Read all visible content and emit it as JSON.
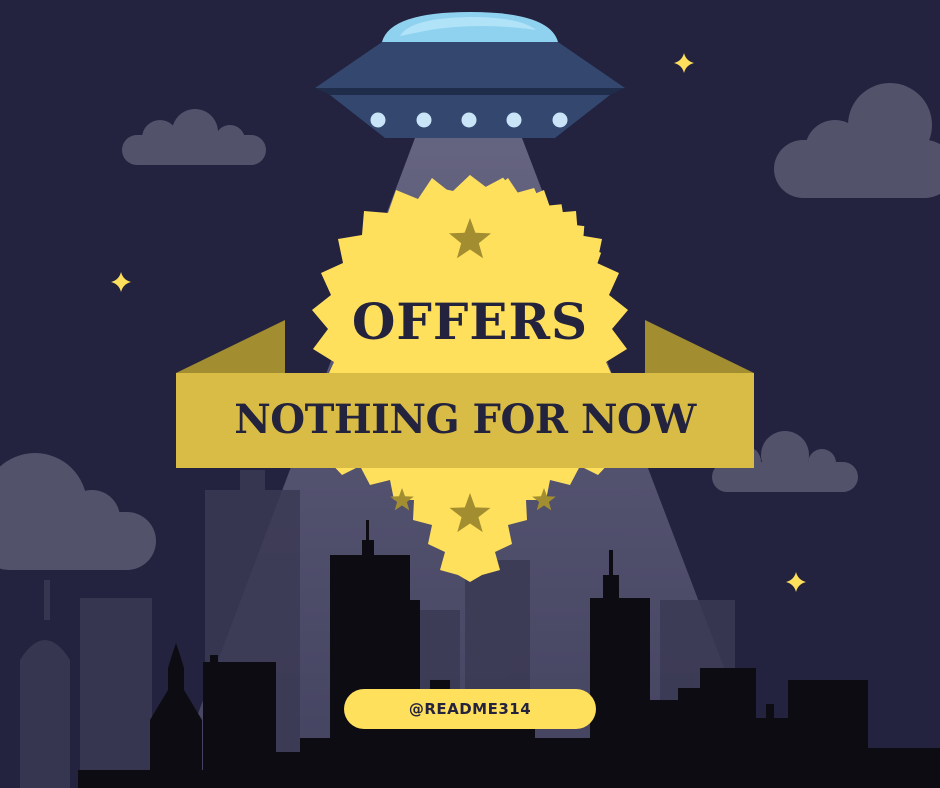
{
  "headline": "OFFERS",
  "banner": "NOTHING FOR NOW",
  "handle": "@README314",
  "colors": {
    "sky": "#23223f",
    "yellow": "#ffe05d",
    "ribbon": "#d8bc45",
    "text": "#24233e",
    "cloud": "#53526b",
    "ufo": "#32456e",
    "dome": "#8fd2f0"
  },
  "icons": [
    "ufo-icon",
    "cloud-icon",
    "sparkle-icon",
    "star-icon",
    "city-skyline"
  ]
}
